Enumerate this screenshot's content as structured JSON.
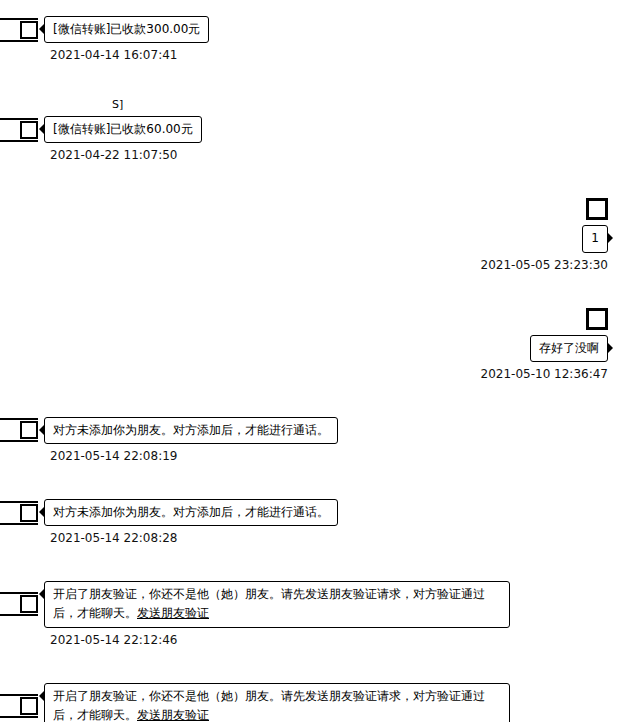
{
  "messages": [
    {
      "side": "left",
      "sender": "",
      "text": "[微信转账]已收款300.00元",
      "link": "",
      "time": "2021-04-14 16:07:41"
    },
    {
      "side": "left",
      "sender": "S]",
      "text": "[微信转账]已收款60.00元",
      "link": "",
      "time": "2021-04-22 11:07:50"
    },
    {
      "side": "right",
      "sender": "",
      "text": "1",
      "link": "",
      "time": "2021-05-05 23:23:30"
    },
    {
      "side": "right",
      "sender": "",
      "text": "存好了没啊",
      "link": "",
      "time": "2021-05-10 12:36:47"
    },
    {
      "side": "left",
      "sender": "",
      "text": "对方未添加你为朋友。对方添加后，才能进行通话。",
      "link": "",
      "time": "2021-05-14 22:08:19"
    },
    {
      "side": "left",
      "sender": "",
      "text": "对方未添加你为朋友。对方添加后，才能进行通话。",
      "link": "",
      "time": "2021-05-14 22:08:28"
    },
    {
      "side": "left",
      "sender": "",
      "text": "开启了朋友验证，你还不是他（她）朋友。请先发送朋友验证请求，对方验证通过后，才能聊天。",
      "link": "发送朋友验证",
      "time": "2021-05-14 22:12:46"
    },
    {
      "side": "left",
      "sender": "",
      "text": "开启了朋友验证，你还不是他（她）朋友。请先发送朋友验证请求，对方验证通过后，才能聊天。",
      "link": "发送朋友验证",
      "time": ""
    }
  ]
}
